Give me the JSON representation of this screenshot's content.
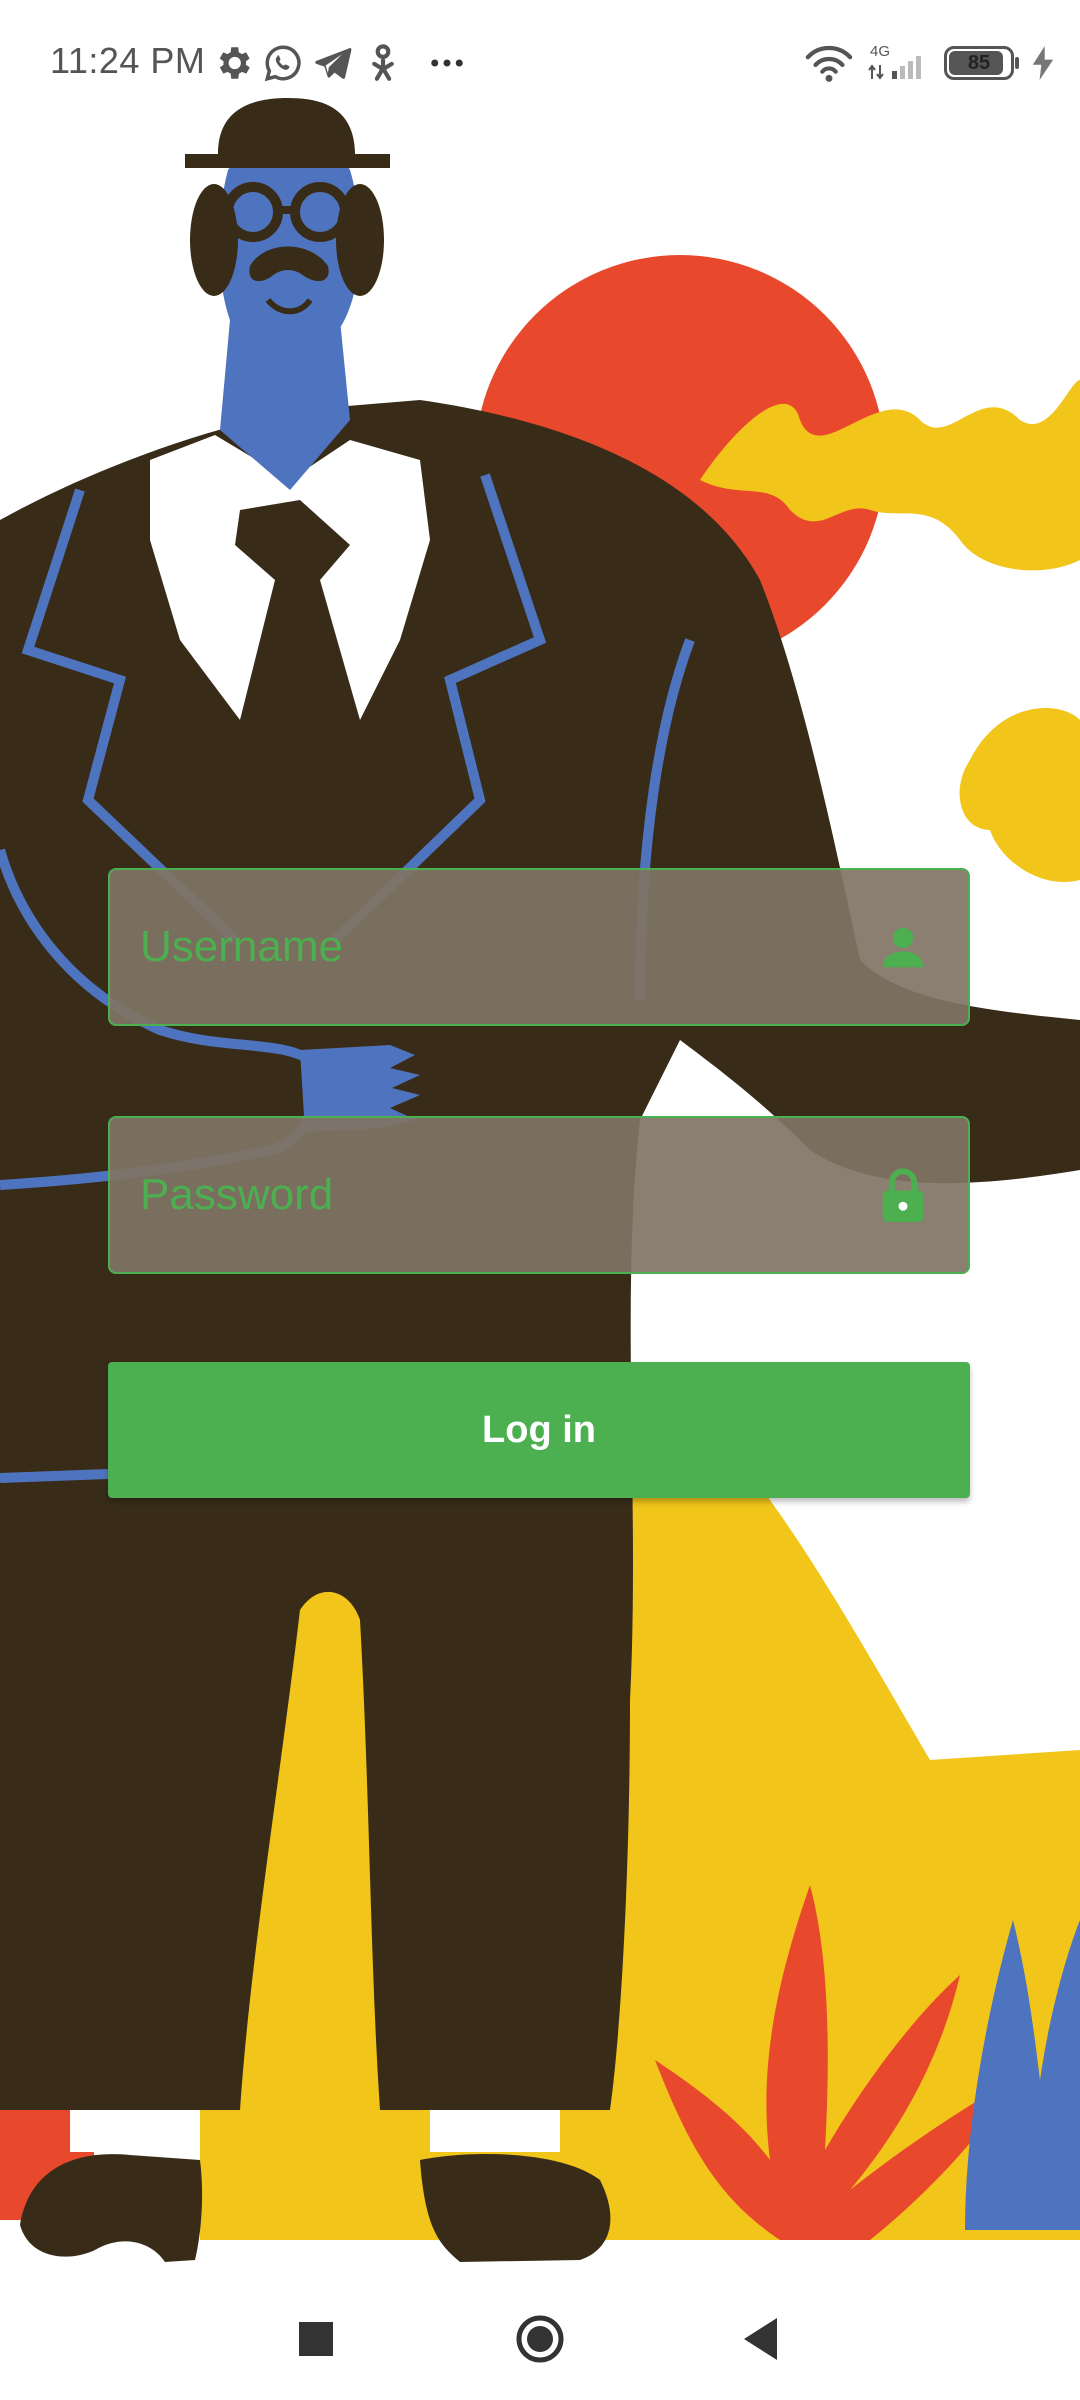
{
  "status_bar": {
    "time": "11:24 PM",
    "icons": [
      "gear-icon",
      "whatsapp-icon",
      "telegram-icon",
      "person-icon",
      "more-dots-icon"
    ],
    "network_label": "4G",
    "battery": "85",
    "battery_level": 0.85
  },
  "form": {
    "username_placeholder": "Username",
    "password_placeholder": "Password",
    "login_label": "Log in"
  },
  "colors": {
    "accent": "#4caf50",
    "field_background": "#7a6e60",
    "suit": "#382c19",
    "face_blue": "#4f74bf",
    "sun_red": "#e8492d",
    "yellow": "#f2c51a"
  },
  "nav_bar": {
    "buttons": [
      "recents-square-icon",
      "home-circle-icon",
      "back-triangle-icon"
    ]
  }
}
